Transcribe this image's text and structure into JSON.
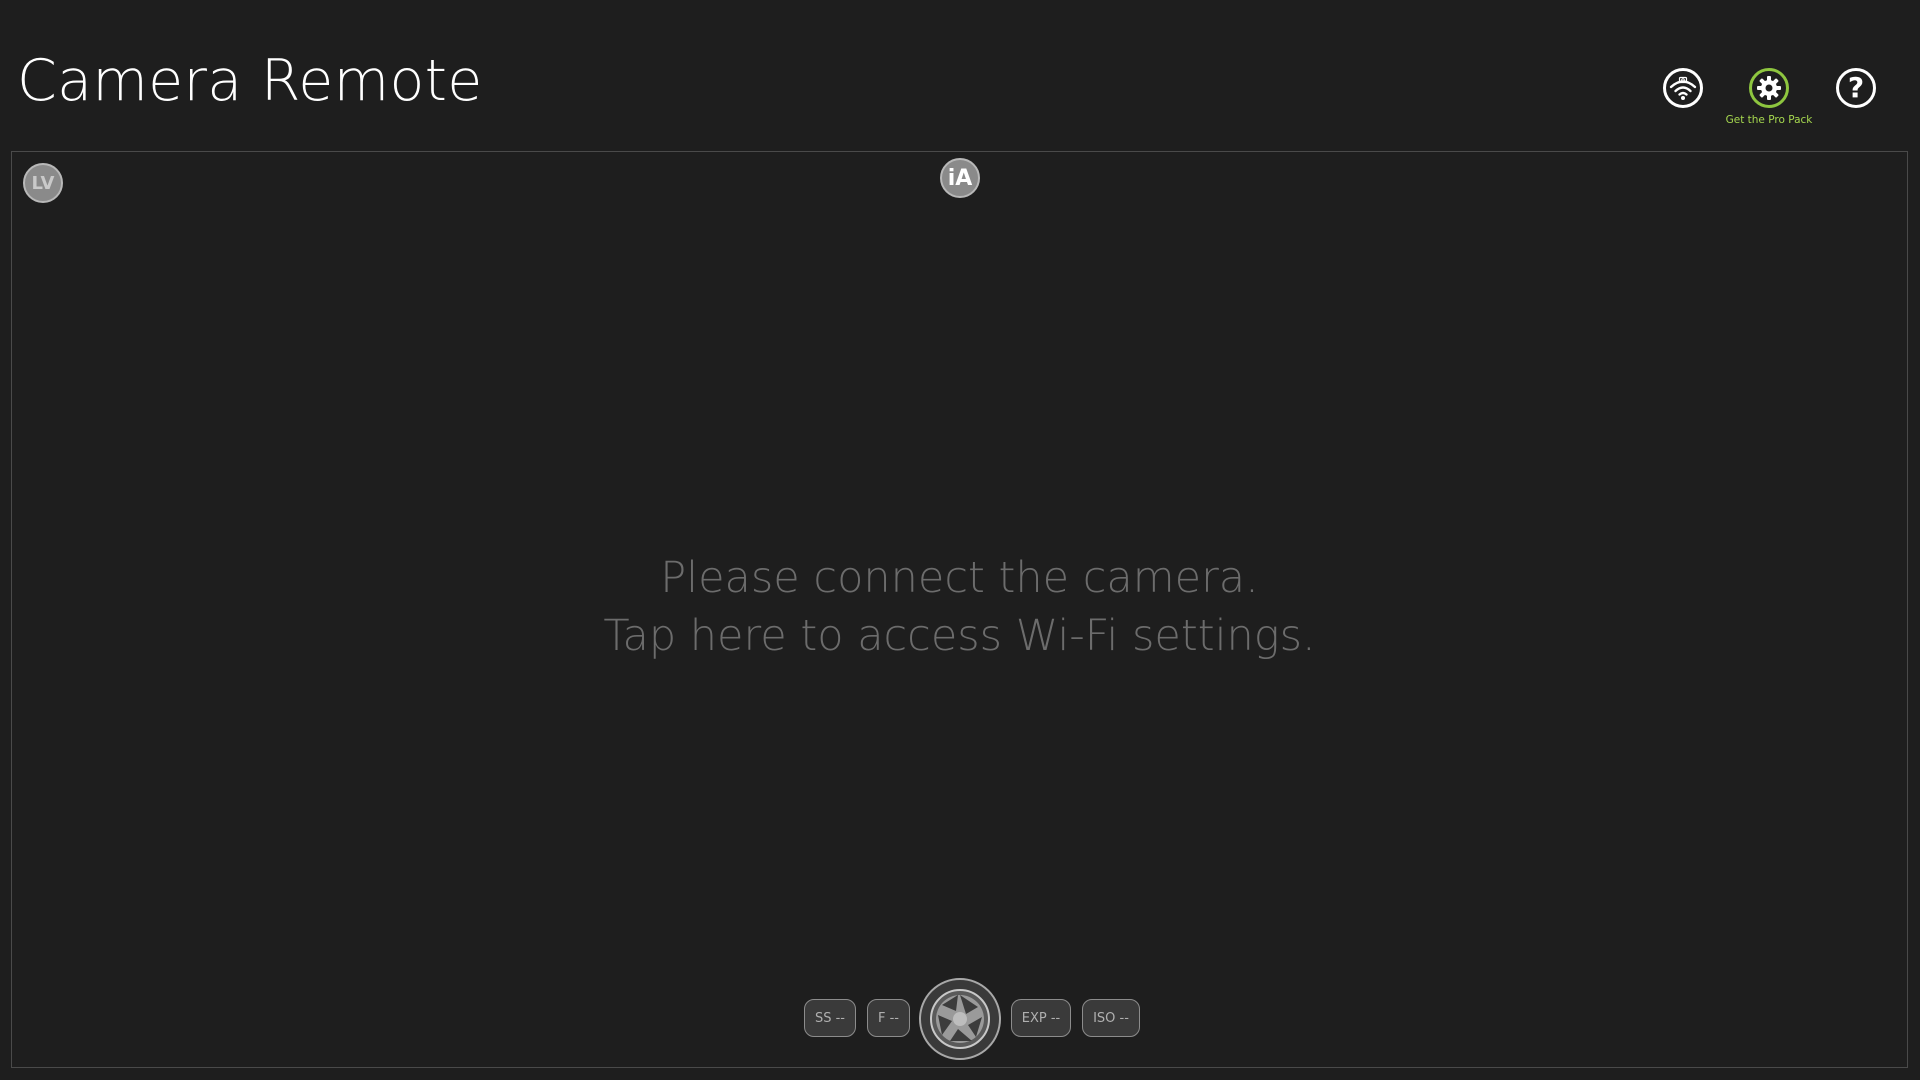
{
  "app": {
    "title": "Camera Remote"
  },
  "toolbar": {
    "wifi_icon": "wifi-camera-icon",
    "settings_icon": "gear-icon",
    "help_icon": "question-icon",
    "help_glyph": "?",
    "pro_pack_label": "Get the Pro Pack",
    "accent_color": "#8ec63f"
  },
  "viewfinder": {
    "lv_badge": "LV",
    "mode_badge": "iA",
    "message_line1": "Please connect the camera.",
    "message_line2": "Tap here to access Wi-Fi settings."
  },
  "controls": {
    "shutter_speed": "SS --",
    "aperture": "F --",
    "shutter_icon": "shutter-aperture-icon",
    "exposure": "EXP --",
    "iso": "ISO --"
  }
}
